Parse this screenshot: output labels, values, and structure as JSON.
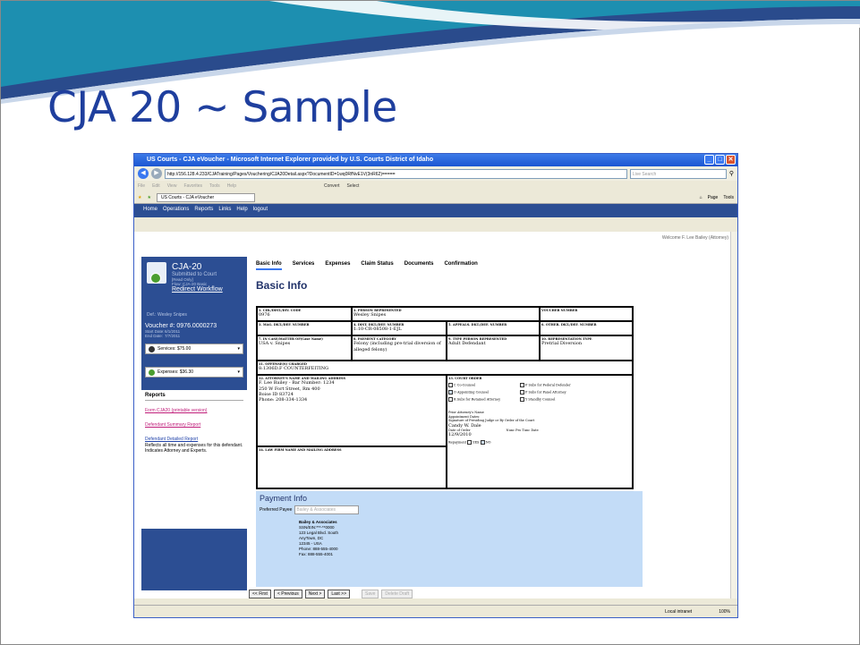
{
  "slide": {
    "title": "CJA 20 ~ Sample"
  },
  "window": {
    "title": "US Courts - CJA eVoucher - Microsoft Internet Explorer provided by U.S. Courts District of Idaho",
    "url": "http://156.128.4.233/CJATraining/Pages/Vouchering/CJA20Detail.aspx?DocumentID=1wq0RfNvE1V(3nR62)===== ",
    "search_placeholder": "Live Search",
    "menu": [
      "File",
      "Edit",
      "View",
      "Favorites",
      "Tools",
      "Help"
    ],
    "convert": "Convert",
    "select": "Select",
    "tab": "US Courts - CJA eVoucher",
    "right_tools": [
      "Page",
      "Tools"
    ]
  },
  "app_nav": [
    "Home",
    "Operations",
    "Reports",
    "Links",
    "Help",
    "logout"
  ],
  "welcome": "Welcome F. Lee Bailey (Attorney)",
  "sidebar": {
    "form_name": "CJA-20",
    "status": "Submitted to Court",
    "readonly": "[Read Only]",
    "flow": "Flow: CJA-20 Basic",
    "redirect": "Redirect Workflow",
    "defendant": "Def.: Wesley Snipes",
    "voucher": "Voucher #:  0976.0000273",
    "start_label": "Start Date:",
    "start_value": "6/1/2011",
    "end_label": "End Date:",
    "end_value": "7/7/2011",
    "services": "Services: $75.00",
    "expenses": "Expenses: $36.30",
    "reports_header": "Reports",
    "report_links": [
      "Form CJA20 (printable version)",
      "Defendant Summary Report",
      "Defendant Detailed Report"
    ],
    "report_note": "Reflects all time and expenses for this defendant. Indicates Attorney and Experts."
  },
  "tabs": [
    "Basic Info",
    "Services",
    "Expenses",
    "Claim Status",
    "Documents",
    "Confirmation"
  ],
  "page_title": "Basic Info",
  "form": {
    "c1l": "1. CIR./DIST./DIV. CODE",
    "c1v": "0976",
    "c2l": "2. PERSON REPRESENTED",
    "c2v": "Wesley Snipes",
    "c3l": "VOUCHER NUMBER",
    "c4l": "3. MAG. DKT./DEF. NUMBER",
    "c5l": "4. DIST. DKT./DEF. NUMBER",
    "c5v": "1:10-CR-08508-1-EJL",
    "c6l": "5. APPEALS. DKT./DEF. NUMBER",
    "c7l": "6. OTHER. DKT./DEF. NUMBER",
    "c8l": "7. IN CASE/MATTER OF(Case Name)",
    "c8v": "USA v. Snipes",
    "c9l": "8. PAYMENT CATEGORY",
    "c9v": "Felony (including pre-trial diversion of alleged felony)",
    "c10l": "9. TYPE PERSON REPRESENTED",
    "c10v": "Adult Defendant",
    "c11l": "10. REPRESENTATION TYPE",
    "c11v": "Pretrial Diversion",
    "c12l": "11. OFFENSE(S) CHARGED",
    "c12v": "8:1306D.F COUNTERFEITING",
    "c13l": "12. ATTORNEY'S NAME AND MAILING ADDRESS",
    "c13v": [
      "F. Lee Bailey - Bar Number: 1234",
      "250 W Fort Street, Rm 400",
      "Boise ID 83724",
      "Phone: 208-334-1334"
    ],
    "c14l": "13. COURT ORDER",
    "orders": [
      "C Co-Counsel",
      "F Subs for Federal Defender",
      "O Appointing Counsel",
      "P Subs for Panel Attorney",
      "R Subs for Retained Attorney",
      "Y Standby Counsel"
    ],
    "prior": "Prior Attorney's Name",
    "appt": "Appointment Dates:",
    "sig": "Signature of Presiding Judge or By Order of the Court",
    "judge": "Candy W. Dale",
    "date_order_l": "Date of Order",
    "nunc_l": "Nunc Pro Tunc Date",
    "date_order_v": "12/9/2010",
    "repay": "Repayment",
    "yes": "YES",
    "no": "NO",
    "c15l": "14. LAW FIRM NAME AND MAILING ADDRESS"
  },
  "payment": {
    "title": "Payment Info",
    "payee_label": "Preferred Payee",
    "payee_value": "Bailey & Associates",
    "address": [
      "Bailey & Associates",
      "SSN/EIN:***-**0000",
      "123 Legal Blvd. South",
      "AnyTown, DC",
      "12345 - USA",
      "Phone: 888-555-4000",
      "Fax: 888-555-4001"
    ]
  },
  "buttons": [
    "<< First",
    "< Previous",
    "Next >",
    "Last >>",
    "Save",
    "Delete Draft"
  ],
  "status_bar": {
    "zone": "Local intranet",
    "zoom": "100%"
  }
}
